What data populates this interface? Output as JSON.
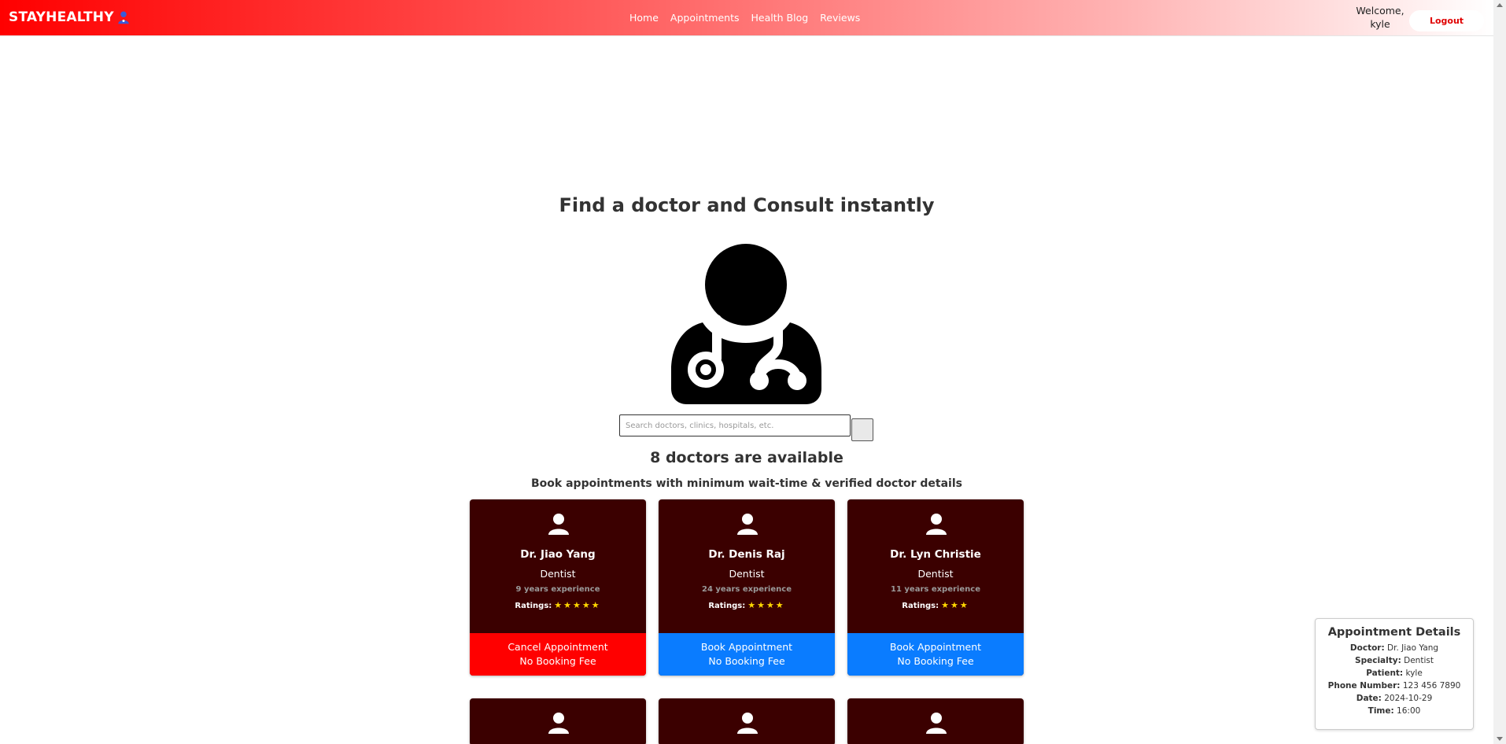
{
  "nav": {
    "brand": "STAYHEALTHY",
    "links": [
      "Home",
      "Appointments",
      "Health Blog",
      "Reviews"
    ],
    "welcome_line1": "Welcome,",
    "welcome_line2": "kyle",
    "logout": "Logout"
  },
  "hero": {
    "title": "Find a doctor and Consult instantly"
  },
  "search": {
    "placeholder": "Search doctors, clinics, hospitals, etc."
  },
  "results": {
    "count_text": "8 doctors are available",
    "subtitle": "Book appointments with minimum wait-time & verified doctor details"
  },
  "doctors": [
    {
      "name": "Dr. Jiao Yang",
      "specialty": "Dentist",
      "experience": "9 years experience",
      "ratings_label": "Ratings:",
      "stars": "★★★★★",
      "button_line1": "Cancel Appointment",
      "button_line2": "No Booking Fee"
    },
    {
      "name": "Dr. Denis Raj",
      "specialty": "Dentist",
      "experience": "24 years experience",
      "ratings_label": "Ratings:",
      "stars": "★★★★",
      "button_line1": "Book Appointment",
      "button_line2": "No Booking Fee"
    },
    {
      "name": "Dr. Lyn Christie",
      "specialty": "Dentist",
      "experience": "11 years experience",
      "ratings_label": "Ratings:",
      "stars": "★★★",
      "button_line1": "Book Appointment",
      "button_line2": "No Booking Fee"
    }
  ],
  "appointment": {
    "title": "Appointment Details",
    "doctor_label": "Doctor:",
    "doctor": "Dr. Jiao Yang",
    "specialty_label": "Specialty:",
    "specialty": "Dentist",
    "patient_label": "Patient:",
    "patient": "kyle",
    "phone_label": "Phone Number:",
    "phone": "123 456 7890",
    "date_label": "Date:",
    "date": "2024-10-29",
    "time_label": "Time:",
    "time": "16:00"
  },
  "colors": {
    "brand_red": "#ff0000",
    "card_bg": "#3b0000",
    "book_blue": "#0a7cff",
    "cancel_red": "#ff0000",
    "star": "#ffd700"
  }
}
